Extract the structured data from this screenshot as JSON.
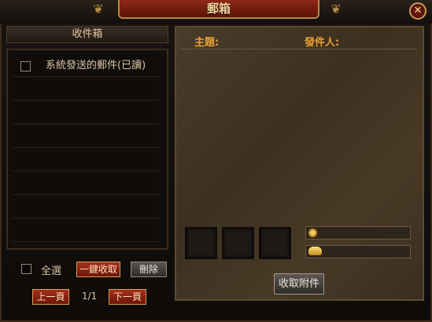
{
  "window": {
    "title": "郵箱",
    "close_label": "✕"
  },
  "inbox": {
    "tab_label": "收件箱",
    "items": [
      {
        "text": "系統發送的郵件(已讀)",
        "checked": false
      },
      {
        "text": ""
      },
      {
        "text": ""
      },
      {
        "text": ""
      },
      {
        "text": ""
      },
      {
        "text": ""
      },
      {
        "text": ""
      },
      {
        "text": ""
      }
    ]
  },
  "controls": {
    "select_all_label": "全選",
    "collect_all_label": "一鍵收取",
    "delete_label": "刪除",
    "prev_label": "上一頁",
    "page_indicator": "1/1",
    "next_label": "下一頁"
  },
  "mail": {
    "subject_label": "主題:",
    "subject_value": "",
    "sender_label": "發件人:",
    "sender_value": "",
    "gold_value": "",
    "ingot_value": "",
    "collect_attachment_label": "收取附件"
  },
  "icons": {
    "gold": "coin-icon",
    "ingot": "ingot-icon",
    "close": "close-icon"
  },
  "colors": {
    "accent": "#e6a233",
    "button_red": "#a72f1b",
    "text": "#d9c6a4"
  }
}
